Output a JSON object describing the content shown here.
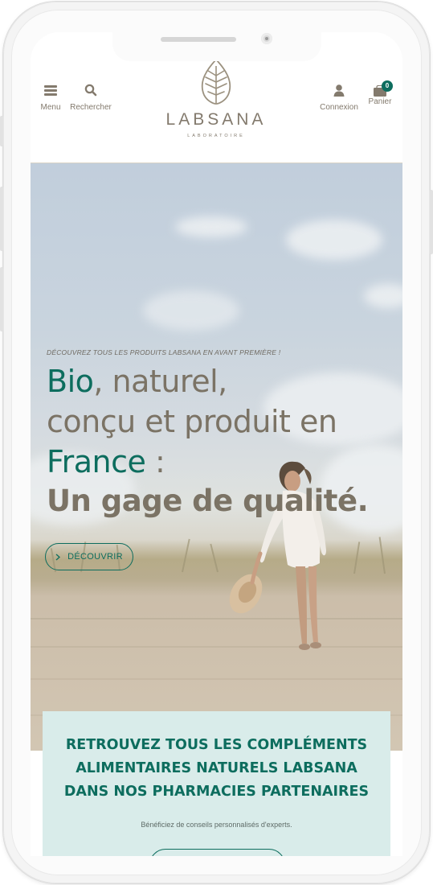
{
  "header": {
    "menu_label": "Menu",
    "search_label": "Rechercher",
    "account_label": "Connexion",
    "cart_label": "Panier",
    "cart_count": "0",
    "brand_name": "LABSANA",
    "brand_tagline": "LABORATOIRE"
  },
  "hero": {
    "eyebrow": "DÉCOUVREZ TOUS LES PRODUITS LABSANA EN AVANT PREMIÈRE !",
    "headline_accent_1": "Bio",
    "headline_part_1": ", naturel,",
    "headline_part_2": "conçu et produit en",
    "headline_accent_2": "France",
    "headline_part_3": " :",
    "headline_bold": "Un gage de qualité.",
    "cta_label": "DÉCOUVRIR"
  },
  "pharmacies": {
    "title": "RETROUVEZ TOUS LES COMPLÉMENTS ALIMENTAIRES NATURELS LABSANA DANS NOS PHARMACIES PARTENAIRES",
    "subtitle": "Bénéficiez de conseils personnalisés d'experts."
  },
  "colors": {
    "accent": "#0d6d5e",
    "brand_taupe": "#837a6d",
    "panel_bg": "#d9ecea"
  },
  "icons": [
    "hamburger-menu-icon",
    "search-icon",
    "user-icon",
    "cart-icon",
    "leaf-logo-icon",
    "chevron-right-icon"
  ]
}
